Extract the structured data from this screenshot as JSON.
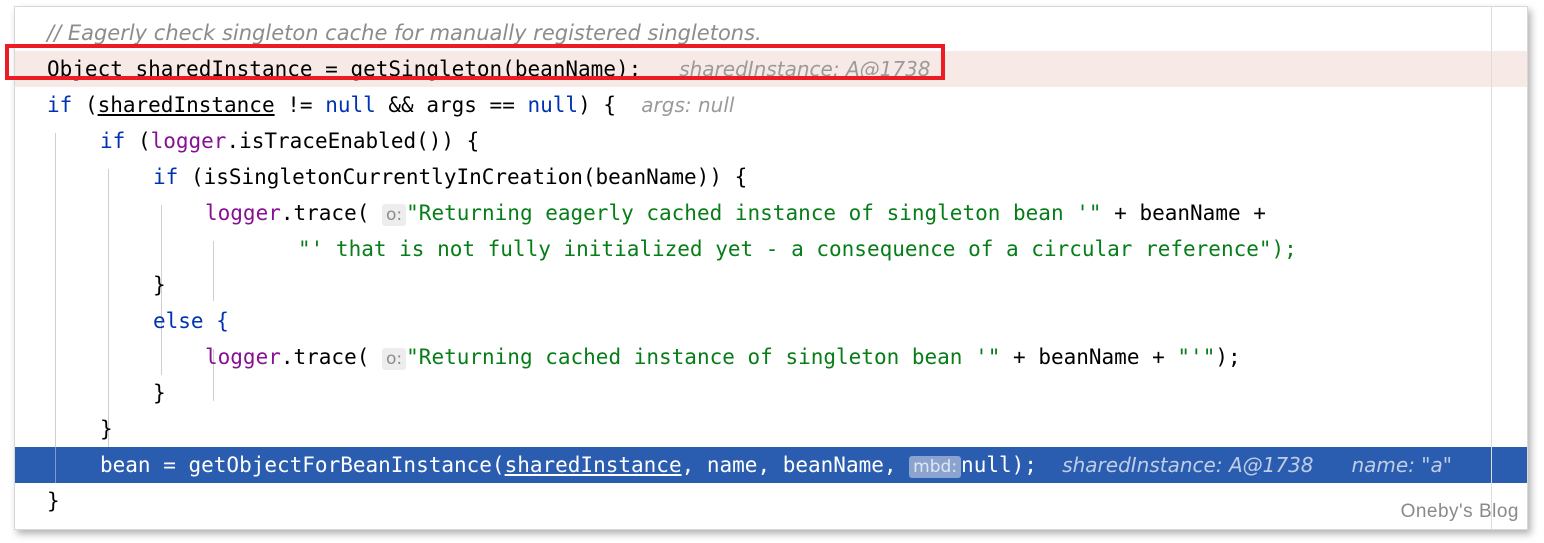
{
  "editor": {
    "watermark": "Oneby's Blog",
    "colors": {
      "keyword": "#0033b3",
      "string": "#067d17",
      "field": "#871094",
      "comment": "#8c8c8c",
      "hint": "#9a9a9a",
      "current_line_bg": "#f7eae6",
      "exec_line_bg": "#2a5db0",
      "annotation_box": "#ed1c24"
    },
    "lines": [
      {
        "id": "line-comment",
        "text": "// Eagerly check singleton cache for manually registered singletons."
      },
      {
        "id": "line-object-sharedinstance",
        "code": "Object sharedInstance = getSingleton(beanName);",
        "keyword": "Object",
        "variable": "sharedInstance",
        "call": "getSingleton(beanName);",
        "hint": "sharedInstance: A@1738"
      },
      {
        "id": "line-if-sharedinstance",
        "if": "if",
        "condition_a": "sharedInstance",
        "op_a": " != ",
        "null_a": "null",
        "op_b": " && args == ",
        "null_b": "null",
        "tail": ") {",
        "hint": "args: null"
      },
      {
        "id": "line-if-istraceenabled",
        "if": "if",
        "receiver": "logger",
        "call": ".isTraceEnabled()) {"
      },
      {
        "id": "line-if-issingletoncurrentlyincreation",
        "if": "if",
        "call": "(isSingletonCurrentlyInCreation(beanName)) {"
      },
      {
        "id": "line-logger-trace-eager",
        "receiver": "logger",
        "method": ".trace( ",
        "badge": "o:",
        "string": "\"Returning eagerly cached instance of singleton bean '\"",
        "concat": " + beanName +"
      },
      {
        "id": "line-trace-eager-continued",
        "string": "\"' that is not fully initialized yet - a consequence of a circular reference\"",
        "tail": ");"
      },
      {
        "id": "line-close-brace-inner-1",
        "text": "}"
      },
      {
        "id": "line-else",
        "text": "else {"
      },
      {
        "id": "line-logger-trace-cached",
        "receiver": "logger",
        "method": ".trace( ",
        "badge": "o:",
        "string_a": "\"Returning cached instance of singleton bean '\"",
        "concat": " + beanName + ",
        "string_b": "\"'\"",
        "tail": ");"
      },
      {
        "id": "line-close-brace-inner-2",
        "text": "}"
      },
      {
        "id": "line-close-brace-outer",
        "text": "}"
      },
      {
        "id": "line-bean-getobjectforbeaninstance",
        "assign": "bean = getObjectForBeanInstance(",
        "variable": "sharedInstance",
        "args": ", name, beanName, ",
        "badge": "mbd:",
        "null_arg": "null);",
        "hint_a": "sharedInstance: A@1738",
        "hint_b": "name: \"a\""
      },
      {
        "id": "line-close-brace-method",
        "text": "}"
      }
    ]
  }
}
